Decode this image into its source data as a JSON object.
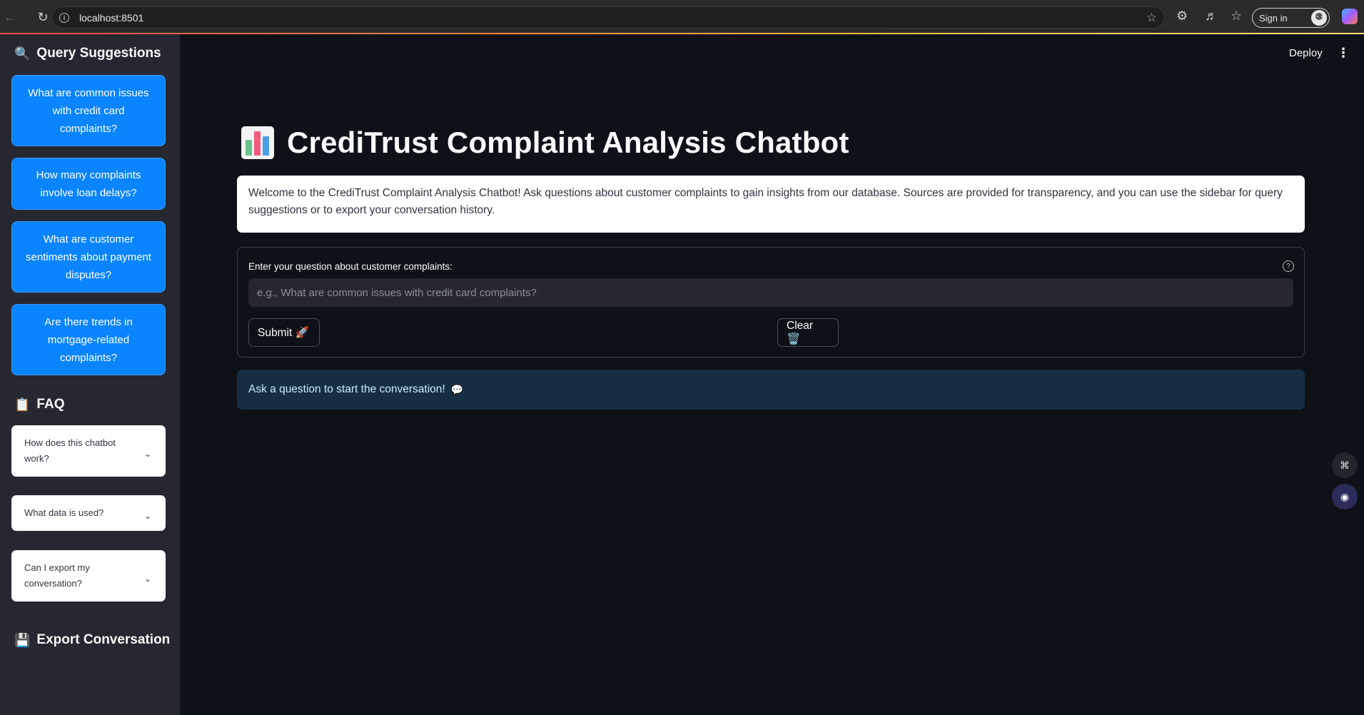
{
  "browser": {
    "url": "localhost:8501",
    "signin_label": "Sign in"
  },
  "sidebar": {
    "query_suggestions_heading": "Query Suggestions",
    "query_suggestions_icon": "🔍",
    "suggestions": [
      "What are common issues with credit card complaints?",
      "How many complaints involve loan delays?",
      "What are customer sentiments about payment disputes?",
      "Are there trends in mortgage-related complaints?"
    ],
    "faq_heading": "FAQ",
    "faq_icon": "📋",
    "faq_items": [
      "How does this chatbot work?",
      "What data is used?",
      "Can I export my conversation?"
    ],
    "export_heading": "Export Conversation",
    "export_icon": "💾"
  },
  "header": {
    "deploy_label": "Deploy",
    "menu_icon": "⋮"
  },
  "main": {
    "title": "CrediTrust Complaint Analysis Chatbot",
    "welcome_text": "Welcome to the CrediTrust Complaint Analysis Chatbot! Ask questions about customer complaints to gain insights from our database. Sources are provided for transparency, and you can use the sidebar for query suggestions or to export your conversation history.",
    "input_label": "Enter your question about customer complaints:",
    "input_placeholder": "e.g., What are common issues with credit card complaints?",
    "input_value": "",
    "submit_label": "Submit 🚀",
    "clear_label": "Clear 🗑️",
    "info_text": "Ask a question to start the conversation!",
    "info_icon": "💬"
  },
  "colors": {
    "accent_blue": "#0a84ff",
    "background": "#0e1117",
    "sidebar": "#262730",
    "info_bg": "#172d43"
  }
}
